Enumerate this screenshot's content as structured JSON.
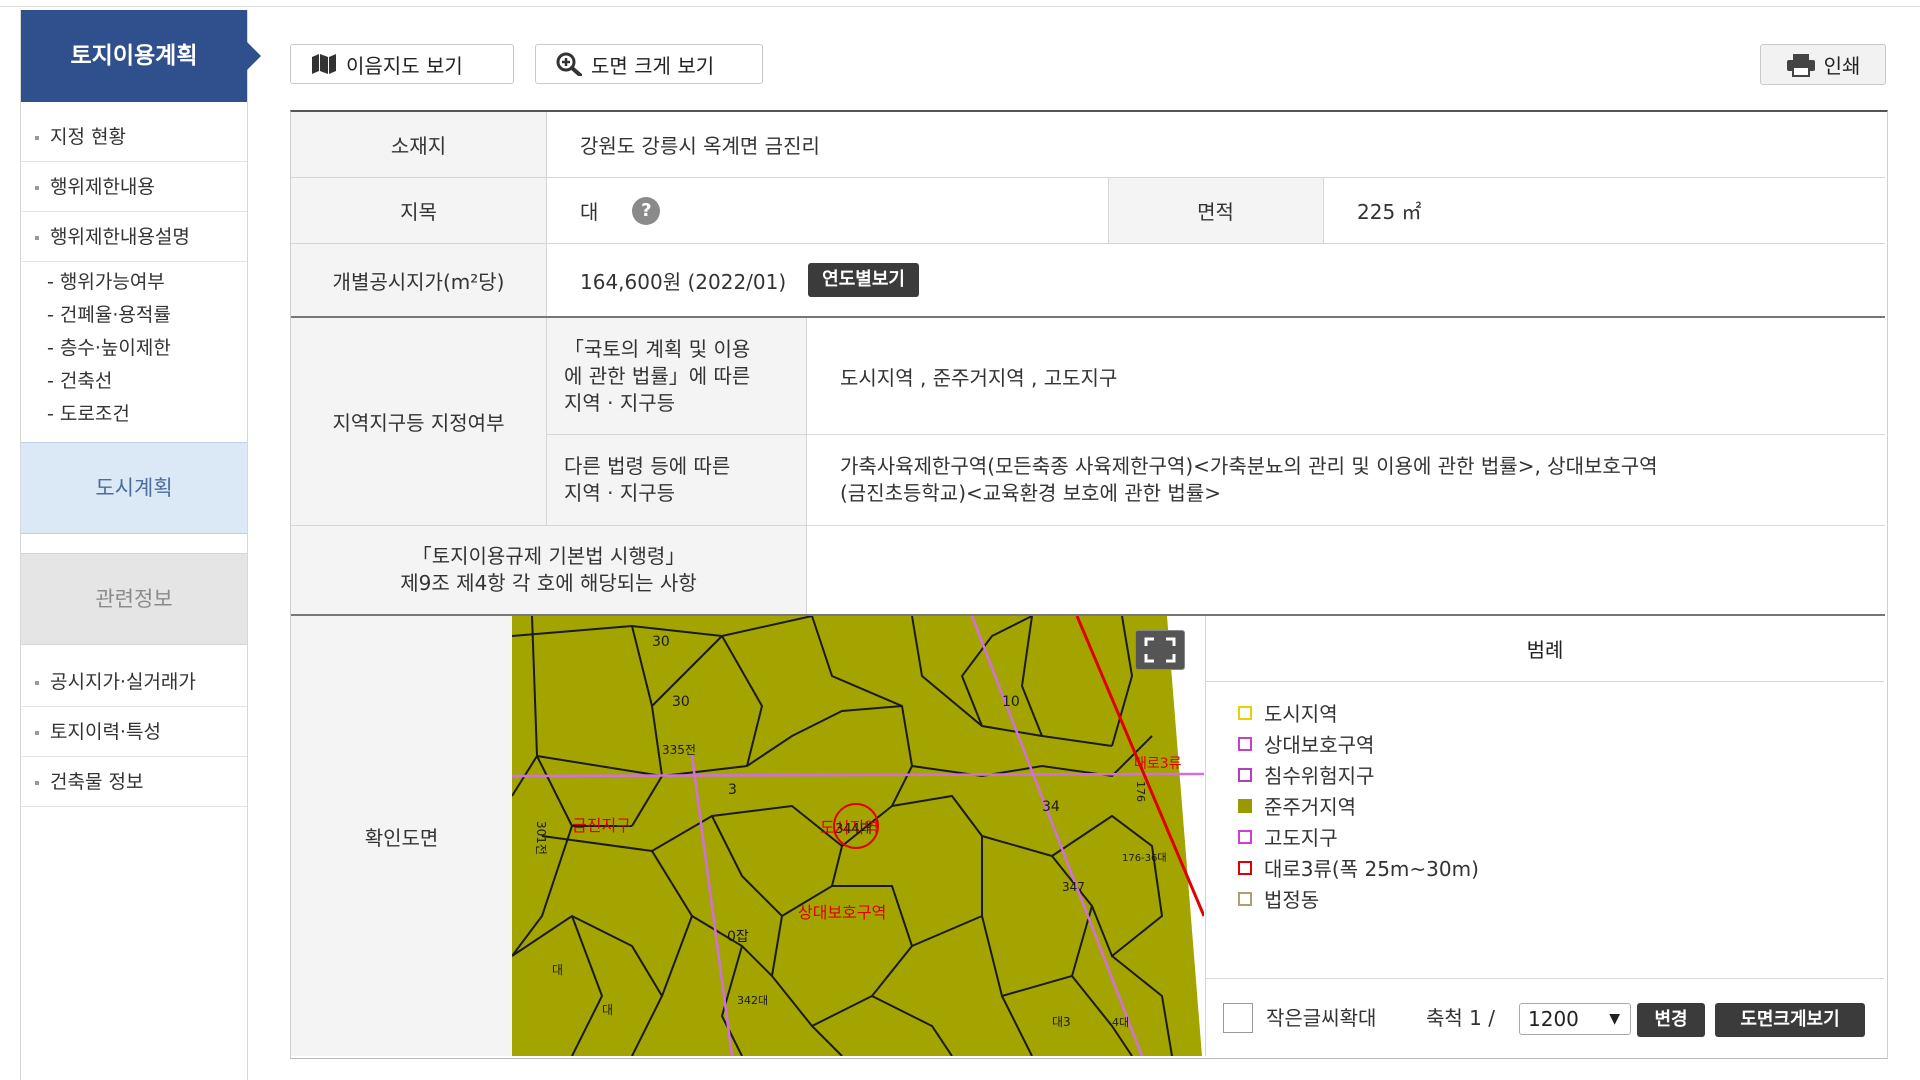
{
  "sidebar": {
    "title": "토지이용계획",
    "items": [
      {
        "label": "지정 현황"
      },
      {
        "label": "행위제한내용"
      },
      {
        "label": "행위제한내용설명"
      }
    ],
    "subitems": [
      {
        "label": "- 행위가능여부"
      },
      {
        "label": "- 건폐율·용적률"
      },
      {
        "label": "- 층수·높이제한"
      },
      {
        "label": "- 건축선"
      },
      {
        "label": "- 도로조건"
      }
    ],
    "city_plan": "도시계획",
    "related_info": "관련정보",
    "related_items": [
      {
        "label": "공시지가·실거래가"
      },
      {
        "label": "토지이력·특성"
      },
      {
        "label": "건축물 정보"
      }
    ]
  },
  "toolbar": {
    "map_view": "이음지도 보기",
    "zoom_view": "도면 크게 보기",
    "print": "인쇄"
  },
  "info": {
    "location_label": "소재지",
    "location_value": "강원도 강릉시 옥계면 금진리",
    "jimok_label": "지목",
    "jimok_value": "대",
    "help": "?",
    "area_label": "면적",
    "area_value": "225 ㎡",
    "price_label": "개별공시지가(m²당)",
    "price_value": "164,600원 (2022/01)",
    "yearly_button": "연도별보기",
    "zone_label": "지역지구등 지정여부",
    "national_law_label_line1": "「국토의 계획 및 이용",
    "national_law_label_line2": "에 관한 법률」에 따른",
    "national_law_label_line3": "지역 · 지구등",
    "national_law_value": "도시지역 , 준주거지역 , 고도지구",
    "other_law_label_line1": "다른 법령 등에 따른",
    "other_law_label_line2": "지역 · 지구등",
    "other_law_value_line1": "가축사육제한구역(모든축종 사육제한구역)<가축분뇨의 관리 및 이용에 관한 법률>, 상대보호구역",
    "other_law_value_line2": "(금진초등학교)<교육환경 보호에 관한 법률>",
    "decree_label_line1": "「토지이용규제 기본법 시행령」",
    "decree_label_line2": "제9조 제4항 각 호에 해당되는 사항",
    "decree_value": "",
    "map_label": "확인도면"
  },
  "map": {
    "labels": {
      "jigu": "금진지구",
      "dosi": "도시지역",
      "sangdae": "상대보호구역",
      "daero": "대로3류",
      "parcel_center": "344대"
    },
    "parcel_numbers": [
      {
        "text": "30"
      },
      {
        "text": "30"
      },
      {
        "text": "335전"
      },
      {
        "text": "3"
      },
      {
        "text": "34"
      },
      {
        "text": "10"
      },
      {
        "text": "301전"
      },
      {
        "text": "347"
      },
      {
        "text": "0잡"
      },
      {
        "text": "342대"
      },
      {
        "text": "대"
      },
      {
        "text": "대"
      },
      {
        "text": "대3"
      },
      {
        "text": "4대"
      },
      {
        "text": "176"
      },
      {
        "text": "176-36대"
      }
    ],
    "colors": {
      "land": "#a4a400",
      "parcel_line": "#1a1a1a",
      "zone_line": "#d070e0",
      "road_line": "#e00000"
    }
  },
  "legend": {
    "title": "범례",
    "items": [
      {
        "label": "도시지역",
        "color": "#e6d200",
        "filled": false
      },
      {
        "label": "상대보호구역",
        "color": "#c840c8",
        "filled": false
      },
      {
        "label": "침수위험지구",
        "color": "#b040c0",
        "filled": false
      },
      {
        "label": "준주거지역",
        "color": "#9a9a00",
        "filled": true
      },
      {
        "label": "고도지구",
        "color": "#d040d0",
        "filled": false
      },
      {
        "label": "대로3류(폭 25m~30m)",
        "color": "#e00000",
        "filled": false
      },
      {
        "label": "법정동",
        "color": "#b0a070",
        "filled": false
      }
    ],
    "small_text": "작은글씨확대",
    "scale_label": "축척 1 /",
    "scale_value": "1200",
    "change_button": "변경",
    "enlarge_button": "도면크게보기"
  }
}
